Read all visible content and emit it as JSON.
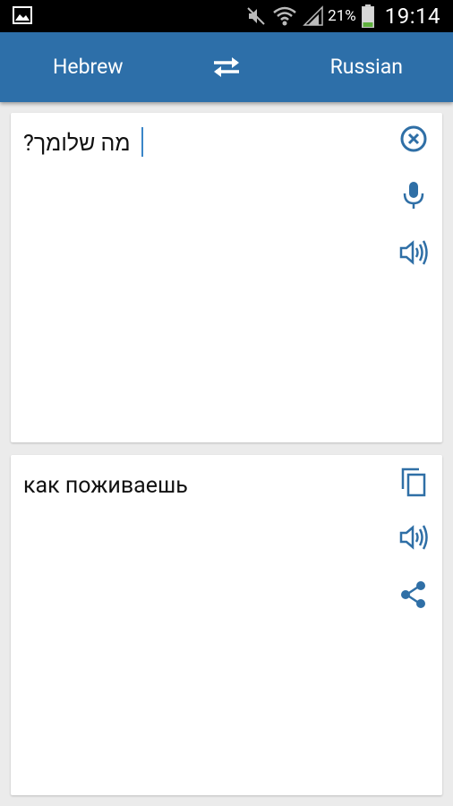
{
  "status_bar": {
    "battery": "21%",
    "time": "19:14",
    "icons": [
      "gallery-icon",
      "mute-icon",
      "wifi-icon",
      "signal-icon",
      "battery-icon"
    ]
  },
  "toolbar": {
    "source_language": "Hebrew",
    "target_language": "Russian",
    "swap_icon": "swap-icon",
    "background_color": "#2d6fa9"
  },
  "input_card": {
    "text": "מה שלומך?",
    "actions": [
      "clear-icon",
      "microphone-icon",
      "speaker-icon"
    ]
  },
  "output_card": {
    "text": "как поживаешь",
    "actions": [
      "copy-icon",
      "speaker-icon",
      "share-icon"
    ]
  },
  "colors": {
    "accent": "#2d6fa9",
    "icon": "#2f6fa6",
    "background": "#ebebeb"
  }
}
